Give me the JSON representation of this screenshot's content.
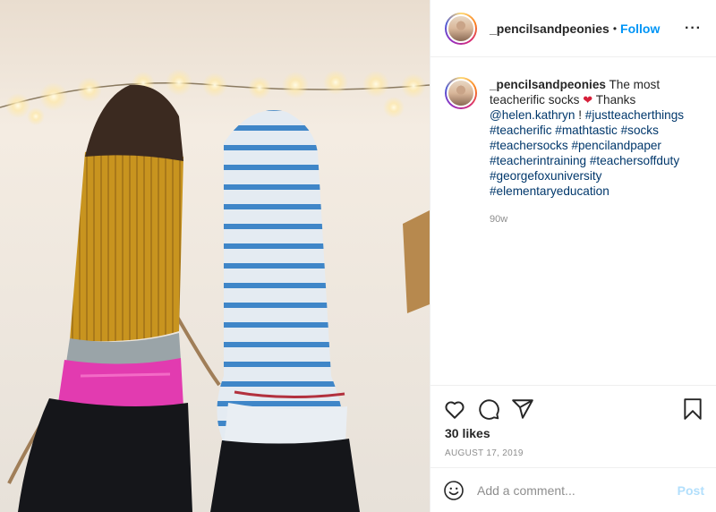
{
  "post": {
    "username": "_pencilsandpeonies",
    "dot": "•",
    "follow_label": "Follow",
    "more_label": "···",
    "caption": {
      "username": "_pencilsandpeonies",
      "text_start": " The most teacherific socks ",
      "heart": "❤",
      "text_thanks": " Thanks ",
      "mention": "@helen.kathryn",
      "after_mention": " ! ",
      "hashtags": [
        "#justteacherthings",
        "#teacherific",
        "#mathtastic",
        "#socks",
        "#teachersocks",
        "#pencilandpaper",
        "#teacherintraining",
        "#teachersoffduty",
        "#georgefoxuniversity",
        "#elementaryeducation"
      ],
      "time_ago": "90w"
    },
    "likes": "30 likes",
    "date": "AUGUST 17, 2019",
    "comment_placeholder": "Add a comment...",
    "post_label": "Post"
  },
  "icons": {
    "like": "heart-icon",
    "comment": "comment-icon",
    "share": "share-icon",
    "save": "bookmark-icon",
    "emoji": "emoji-icon"
  },
  "colors": {
    "follow": "#0095f6",
    "link": "#00376b",
    "post_disabled": "#b2dffc",
    "muted": "#8e8e8e"
  }
}
